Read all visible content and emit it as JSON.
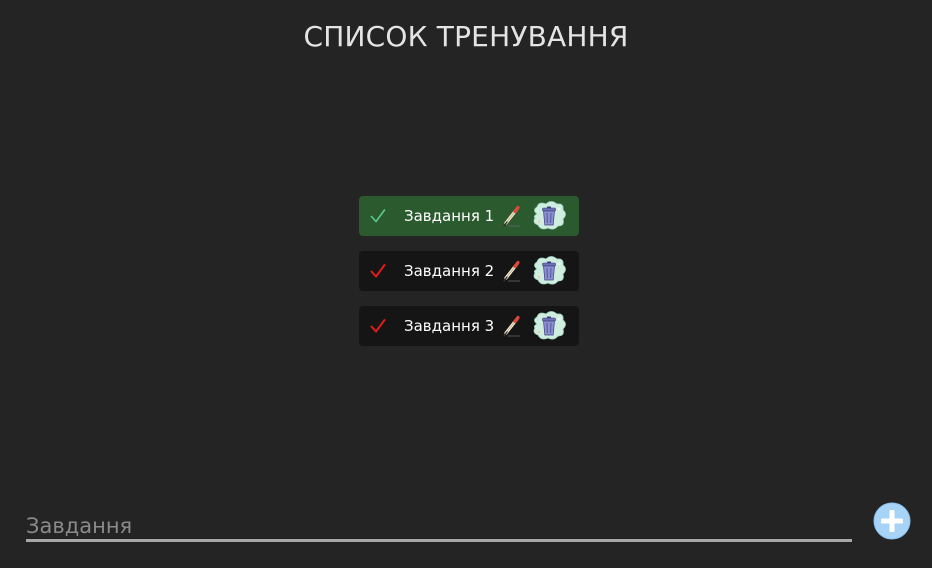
{
  "header": {
    "title": "СПИСОК ТРЕНУВАННЯ"
  },
  "tasks": [
    {
      "label": "Завдання 1",
      "done": true
    },
    {
      "label": "Завдання 2",
      "done": false
    },
    {
      "label": "Завдання 3",
      "done": false
    }
  ],
  "input": {
    "placeholder": "Завдання",
    "value": ""
  },
  "icons": {
    "check": "check-icon",
    "edit": "pencil-icon",
    "delete": "trash-bin-icon",
    "add": "plus-circle-icon"
  },
  "colors": {
    "background": "#242424",
    "task_done_bg": "#2a5a2e",
    "task_bg": "#151515",
    "check_done": "#5ec990",
    "check_pending": "#e21b1b",
    "add_button": "#a7d3f7"
  }
}
